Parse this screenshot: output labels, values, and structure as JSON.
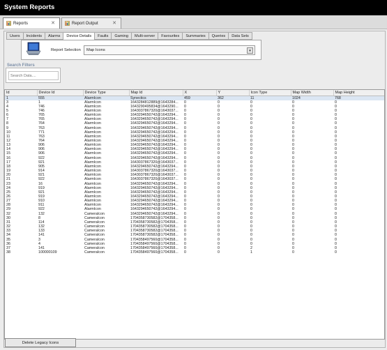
{
  "window": {
    "title": "System Reports"
  },
  "doc_tabs": [
    {
      "label": "Reports",
      "icon": "reports-icon",
      "active": true
    },
    {
      "label": "Report Output",
      "icon": "report-output-icon",
      "active": false
    }
  ],
  "sub_tabs": [
    "Users",
    "Incidents",
    "Alarms",
    "Device Details",
    "Faults",
    "Gaming",
    "Multi-server",
    "Favourites",
    "Summaries",
    "Queries",
    "Data Sets"
  ],
  "active_sub_tab": "Device Details",
  "report_selection": {
    "label": "Report Selection",
    "value": "Map Icons"
  },
  "search_filters": {
    "title": "Search Filters",
    "placeholder": "Search Data...."
  },
  "grid": {
    "columns": [
      "Id",
      "Device Id",
      "Device Type",
      "Map Id",
      "X",
      "Y",
      "Icon Type",
      "Map Width",
      "Map Height"
    ],
    "rows": [
      [
        "1",
        "555",
        "AlarmIcon",
        "Synectics",
        "459",
        "362",
        "11",
        "1024",
        "768"
      ],
      [
        "3",
        "1",
        "AlarmIcon",
        "1643284812889@1643284...",
        "0",
        "0",
        "0",
        "0",
        "0"
      ],
      [
        "4",
        "746",
        "AlarmIcon",
        "1643290495834@1643290...",
        "0",
        "0",
        "0",
        "0",
        "0"
      ],
      [
        "5",
        "746",
        "AlarmIcon",
        "1643037867320@1643037...",
        "0",
        "0",
        "0",
        "0",
        "0"
      ],
      [
        "6",
        "765",
        "AlarmIcon",
        "1643294650742@1643294...",
        "0",
        "0",
        "0",
        "0",
        "0"
      ],
      [
        "7",
        "765",
        "AlarmIcon",
        "1643294650742@1643294...",
        "0",
        "0",
        "0",
        "0",
        "0"
      ],
      [
        "8",
        "764",
        "AlarmIcon",
        "1643294650742@1643294...",
        "0",
        "0",
        "0",
        "0",
        "0"
      ],
      [
        "9",
        "763",
        "AlarmIcon",
        "1643294650742@1643294...",
        "0",
        "0",
        "0",
        "0",
        "0"
      ],
      [
        "10",
        "771",
        "AlarmIcon",
        "1643294650742@1643294...",
        "0",
        "0",
        "0",
        "0",
        "0"
      ],
      [
        "11",
        "763",
        "AlarmIcon",
        "1643294650742@1643294...",
        "0",
        "0",
        "0",
        "0",
        "0"
      ],
      [
        "12",
        "764",
        "AlarmIcon",
        "1643294650742@1643294...",
        "0",
        "0",
        "0",
        "0",
        "0"
      ],
      [
        "13",
        "906",
        "AlarmIcon",
        "1643294650742@1643294...",
        "0",
        "0",
        "0",
        "0",
        "0"
      ],
      [
        "14",
        "906",
        "AlarmIcon",
        "1643294650742@1643294...",
        "0",
        "0",
        "0",
        "0",
        "0"
      ],
      [
        "15",
        "906",
        "AlarmIcon",
        "1643294650742@1643294...",
        "0",
        "0",
        "0",
        "0",
        "0"
      ],
      [
        "16",
        "922",
        "AlarmIcon",
        "1643294650742@1643294...",
        "0",
        "0",
        "0",
        "0",
        "0"
      ],
      [
        "17",
        "921",
        "AlarmIcon",
        "1643037867320@1643037...",
        "0",
        "0",
        "0",
        "0",
        "0"
      ],
      [
        "18",
        "905",
        "AlarmIcon",
        "1643294650742@1643294...",
        "0",
        "0",
        "0",
        "0",
        "0"
      ],
      [
        "19",
        "914",
        "AlarmIcon",
        "1643037867320@1643037...",
        "0",
        "0",
        "0",
        "0",
        "0"
      ],
      [
        "20",
        "921",
        "AlarmIcon",
        "1643037867320@1643037...",
        "0",
        "0",
        "0",
        "0",
        "0"
      ],
      [
        "21",
        "922",
        "AlarmIcon",
        "1643037867320@1643037...",
        "0",
        "0",
        "0",
        "0",
        "0"
      ],
      [
        "23",
        "16",
        "AlarmIcon",
        "1643294650742@1643294...",
        "0",
        "0",
        "0",
        "0",
        "0"
      ],
      [
        "24",
        "919",
        "AlarmIcon",
        "1643294650742@1643294...",
        "0",
        "0",
        "0",
        "0",
        "0"
      ],
      [
        "25",
        "921",
        "AlarmIcon",
        "1643294650742@1643294...",
        "0",
        "0",
        "0",
        "0",
        "0"
      ],
      [
        "26",
        "919",
        "AlarmIcon",
        "1643294650742@1643294...",
        "0",
        "0",
        "0",
        "0",
        "0"
      ],
      [
        "27",
        "910",
        "AlarmIcon",
        "1643294650742@1643294...",
        "0",
        "0",
        "0",
        "0",
        "0"
      ],
      [
        "28",
        "911",
        "AlarmIcon",
        "1643294650742@1643294...",
        "0",
        "0",
        "0",
        "0",
        "0"
      ],
      [
        "29",
        "922",
        "AlarmIcon",
        "1643294650742@1643294...",
        "0",
        "0",
        "0",
        "0",
        "0"
      ],
      [
        "32",
        "132",
        "CameraIcon",
        "1643294650742@1643294...",
        "0",
        "0",
        "0",
        "0",
        "0"
      ],
      [
        "30",
        "8",
        "CameraIcon",
        "1704358730582@1704358...",
        "0",
        "0",
        "0",
        "0",
        "0"
      ],
      [
        "31",
        "114",
        "CameraIcon",
        "1704358730582@1704358...",
        "0",
        "0",
        "0",
        "0",
        "0"
      ],
      [
        "32",
        "132",
        "CameraIcon",
        "1704358730582@1704358...",
        "0",
        "0",
        "0",
        "0",
        "0"
      ],
      [
        "33",
        "133",
        "CameraIcon",
        "1704358730582@1704358...",
        "0",
        "0",
        "0",
        "0",
        "0"
      ],
      [
        "34",
        "141",
        "CameraIcon",
        "1704358730582@1704358...",
        "0",
        "0",
        "0",
        "0",
        "0"
      ],
      [
        "35",
        "3",
        "CameraIcon",
        "1704358497560@1704358...",
        "0",
        "0",
        "0",
        "0",
        "0"
      ],
      [
        "36",
        "4",
        "CameraIcon",
        "1704358497560@1704358...",
        "0",
        "0",
        "0",
        "0",
        "0"
      ],
      [
        "37",
        "141",
        "CameraIcon",
        "1704358497560@1704358...",
        "0",
        "0",
        "2",
        "0",
        "0"
      ],
      [
        "38",
        "100000109",
        "CameraIcon",
        "1704358497560@1704358...",
        "0",
        "0",
        "1",
        "0",
        "0"
      ]
    ]
  },
  "delete_button": {
    "label": "Delete Legacy Icons"
  }
}
